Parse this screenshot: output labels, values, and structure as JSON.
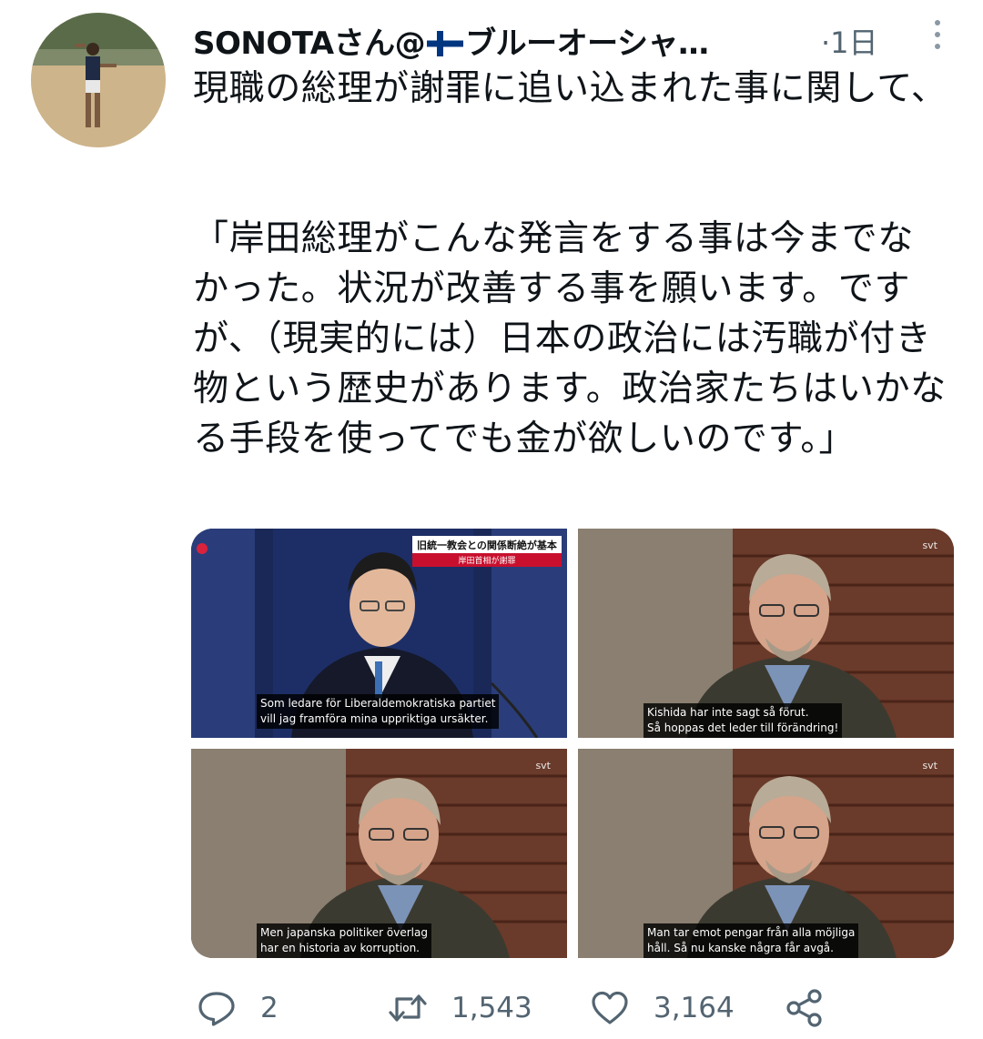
{
  "tweet": {
    "display_name": "SONOTAさん@",
    "display_name_suffix": "ブルーオーシャ…",
    "time": "·1日",
    "text": "現職の総理が謝罪に追い込まれた事に関して、\n\n\n「岸田総理がこんな発言をする事は今までなかった。状況が改善する事を願います。ですが、（現実的には）日本の政治には汚職が付き物という歴史があります。政治家たちはいかなる手段を使ってでも金が欲しいのです。」"
  },
  "media": [
    {
      "ticker": "旧統一教会との関係断絶が基本",
      "ticker_sub": "岸田首相が謝罪",
      "subtitle": "Som ledare för Liberaldemokratiska partiet\nvill jag framföra mina uppriktiga ursäkter."
    },
    {
      "logo": "svt",
      "subtitle": "Kishida har inte sagt så förut.\nSå hoppas det leder till förändring!"
    },
    {
      "logo": "svt",
      "subtitle": "Men japanska politiker överlag\nhar en historia av korruption."
    },
    {
      "logo": "svt",
      "subtitle": "Man tar emot pengar från alla möjliga\nhåll. Så nu kanske några får avgå."
    }
  ],
  "actions": {
    "reply_count": "2",
    "retweet_count": "1,543",
    "like_count": "3,164"
  },
  "icons": {
    "more": "more-vertical-icon",
    "reply": "reply-icon",
    "retweet": "retweet-icon",
    "like": "heart-icon",
    "share": "share-icon",
    "flag": "finland-flag-icon"
  },
  "colors": {
    "text": "#0f1419",
    "secondary": "#536471",
    "flag_blue": "#003580"
  }
}
